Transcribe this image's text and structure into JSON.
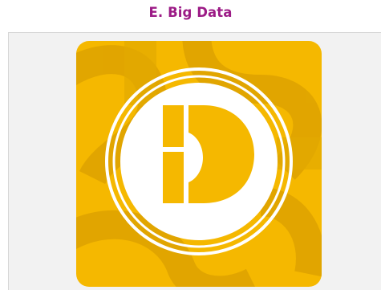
{
  "section": {
    "title": "E. Big Data"
  },
  "logo": {
    "icon": "big-data-logo-icon",
    "letter": "B",
    "colors": {
      "background": "#f5b800",
      "pattern": "#e0a500",
      "ring": "#ffffff",
      "disc_center": "#ffffff",
      "glyph": "#f5b800"
    }
  },
  "colors": {
    "title": "#9c1b86",
    "panel_background": "#f2f2f2",
    "panel_border": "#d6d6d6"
  }
}
